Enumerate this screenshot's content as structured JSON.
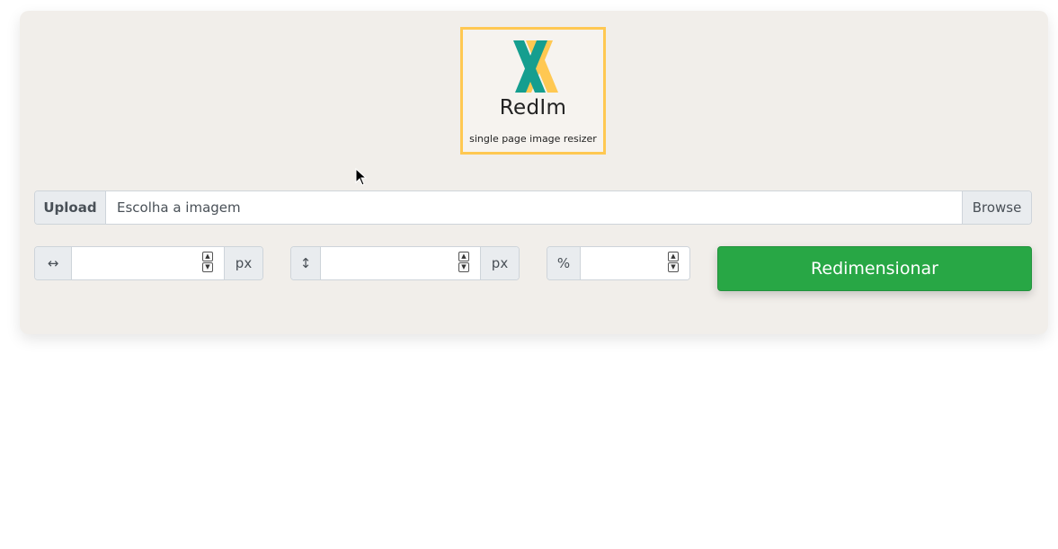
{
  "logo": {
    "title": "RedIm",
    "subtitle": "single page image resizer",
    "colors": {
      "frame": "#ffc852",
      "teal": "#159e8f",
      "yellow": "#ffc852"
    }
  },
  "upload": {
    "label": "Upload",
    "placeholder": "Escolha a imagem",
    "browse_label": "Browse"
  },
  "width": {
    "icon": "horizontal-arrow-icon",
    "glyph": "↔",
    "unit": "px",
    "value": ""
  },
  "height": {
    "icon": "vertical-arrow-icon",
    "glyph": "↕",
    "unit": "px",
    "value": ""
  },
  "percent": {
    "symbol": "%",
    "value": ""
  },
  "action": {
    "resize_label": "Redimensionar",
    "color": "#28a745"
  },
  "spinner": {
    "up": "▲",
    "down": "▼"
  }
}
